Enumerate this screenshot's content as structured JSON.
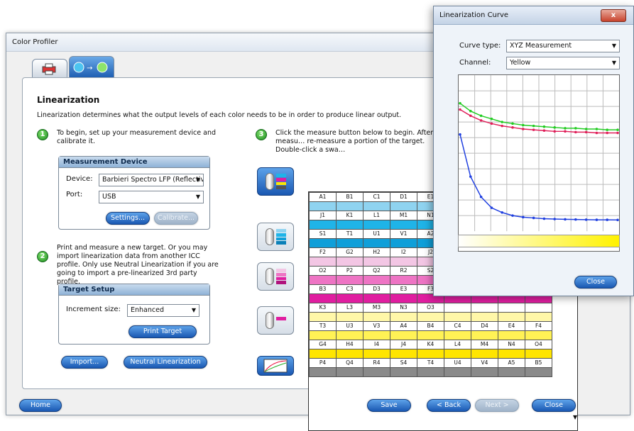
{
  "main_window": {
    "title": "Color Profiler",
    "heading": "Linearization",
    "description": "Linearization determines what the output levels of each color needs to be in order to produce linear output.",
    "step1": {
      "number": "1",
      "text": "To begin, set up your measurement device and calibrate it."
    },
    "step2": {
      "number": "2",
      "text": "Print and measure a new target. Or you may import linearization data from another ICC profile. Only use Neutral Linearization if you are going to import a pre-linearized 3rd party profile."
    },
    "step3": {
      "number": "3",
      "text": "Click the measure button below to begin. After measu… re-measure a portion of the target. Double-click a swa…"
    },
    "measurement_device": {
      "title": "Measurement Device",
      "device_label": "Device:",
      "device_value": "Barbieri Spectro LFP (Reflectiv",
      "port_label": "Port:",
      "port_value": "USB",
      "settings_button": "Settings...",
      "calibrate_button": "Calibrate..."
    },
    "target_setup": {
      "title": "Target Setup",
      "increment_label": "Increment size:",
      "increment_value": "Enhanced",
      "print_button": "Print Target"
    },
    "import_button": "Import...",
    "neutral_button": "Neutral Linearization",
    "footer": {
      "home": "Home",
      "save": "Save",
      "back": "< Back",
      "next": "Next >",
      "close": "Close"
    }
  },
  "patch_grid": {
    "rows": [
      {
        "labels": [
          "A1",
          "B1",
          "C1",
          "D1",
          "E1",
          "",
          "",
          "",
          ""
        ],
        "color": "#8fd3f0"
      },
      {
        "labels": [
          "J1",
          "K1",
          "L1",
          "M1",
          "N1",
          "",
          "",
          "",
          ""
        ],
        "color": "#1fb4e8"
      },
      {
        "labels": [
          "S1",
          "T1",
          "U1",
          "V1",
          "A2",
          "",
          "",
          "",
          ""
        ],
        "color": "#0f9fd9"
      },
      {
        "labels": [
          "F2",
          "G2",
          "H2",
          "I2",
          "J2",
          "",
          "",
          "",
          ""
        ],
        "color": "#f3c6e4"
      },
      {
        "labels": [
          "O2",
          "P2",
          "Q2",
          "R2",
          "S2",
          "",
          "",
          "",
          ""
        ],
        "color": "#ee74c4"
      },
      {
        "labels": [
          "B3",
          "C3",
          "D3",
          "E3",
          "F3",
          "",
          "",
          "",
          ""
        ],
        "color": "#e01ea0"
      },
      {
        "labels": [
          "K3",
          "L3",
          "M3",
          "N3",
          "O3",
          "",
          "",
          "",
          ""
        ],
        "color": "#fff7a8"
      },
      {
        "labels": [
          "T3",
          "U3",
          "V3",
          "A4",
          "B4",
          "C4",
          "D4",
          "E4",
          "F4"
        ],
        "color": "#fff255"
      },
      {
        "labels": [
          "G4",
          "H4",
          "I4",
          "J4",
          "K4",
          "L4",
          "M4",
          "N4",
          "O4"
        ],
        "color": "#ffe500"
      },
      {
        "labels": [
          "P4",
          "Q4",
          "R4",
          "S4",
          "T4",
          "U4",
          "V4",
          "A5",
          "B5"
        ],
        "color": "#8a8a8a"
      }
    ]
  },
  "curve_dialog": {
    "title": "Linearization Curve",
    "close_x": "x",
    "curve_type_label": "Curve type:",
    "curve_type_value": "XYZ Measurement",
    "channel_label": "Channel:",
    "channel_value": "Yellow",
    "close_button": "Close",
    "series_colors": [
      "#22cc22",
      "#e0205a",
      "#1f3fe0"
    ]
  },
  "chart_data": {
    "type": "line",
    "series": [
      {
        "values": [
          0.82,
          0.77,
          0.74,
          0.72,
          0.7,
          0.69,
          0.68,
          0.675,
          0.67,
          0.665,
          0.66,
          0.66,
          0.655,
          0.655,
          0.65,
          0.65
        ]
      },
      {
        "values": [
          0.78,
          0.74,
          0.71,
          0.69,
          0.675,
          0.665,
          0.655,
          0.65,
          0.645,
          0.64,
          0.64,
          0.635,
          0.635,
          0.63,
          0.63,
          0.63
        ]
      },
      {
        "values": [
          0.62,
          0.35,
          0.22,
          0.15,
          0.12,
          0.1,
          0.09,
          0.085,
          0.08,
          0.078,
          0.076,
          0.075,
          0.074,
          0.073,
          0.073,
          0.072
        ]
      }
    ],
    "grid": true
  }
}
